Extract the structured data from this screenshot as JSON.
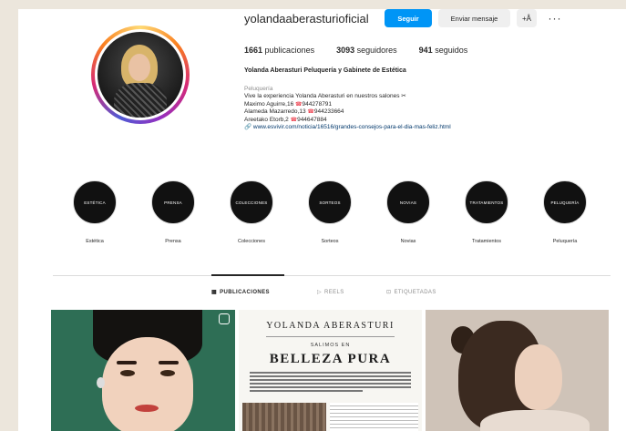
{
  "profile": {
    "username": "yolandaaberasturioficial",
    "follow_label": "Seguir",
    "message_label": "Enviar mensaje",
    "add_user_label": "+Å",
    "more_label": "···",
    "posts_count": "1661",
    "posts_label": "publicaciones",
    "followers_count": "3093",
    "followers_label": "seguidores",
    "following_count": "941",
    "following_label": "seguidos",
    "full_name": "Yolanda Aberasturi Peluquería y Gabinete de Estética",
    "category": "Peluquería",
    "bio_line1": "Vive la experiencia Yolanda Aberasturi en nuestros salones",
    "addresses": [
      {
        "text": "Maximo Aguirre,16",
        "phone": "944278791"
      },
      {
        "text": "Alameda Mazarredo,13",
        "phone": "944233664"
      },
      {
        "text": "Areetako Etorb,2",
        "phone": "944647884"
      }
    ],
    "link": "www.esvivir.com/noticia/16516/grandes-consejos-para-el-dia-mas-feliz.html"
  },
  "highlights": [
    {
      "cover": "ESTÉTICA",
      "label": "Estética"
    },
    {
      "cover": "PRENSA",
      "label": "Prensa"
    },
    {
      "cover": "COLECCIONES",
      "label": "Colecciones"
    },
    {
      "cover": "SORTEOS",
      "label": "Sorteos"
    },
    {
      "cover": "NOVIAS",
      "label": "Novias"
    },
    {
      "cover": "TRATAMIENTOS",
      "label": "Tratamientos"
    },
    {
      "cover": "PELUQUERÍA",
      "label": "Peluquería"
    }
  ],
  "tabs": {
    "posts": "PUBLICACIONES",
    "reels": "REELS",
    "tagged": "ETIQUETADAS"
  },
  "posts": {
    "post2_title": "YOLANDA ABERASTURI",
    "post2_sub": "SALIMOS EN",
    "post2_head": "BELLEZA PURA"
  },
  "colors": {
    "follow_button": "#0095f6",
    "phone_icon": "#ed4956",
    "link": "#00376b"
  }
}
